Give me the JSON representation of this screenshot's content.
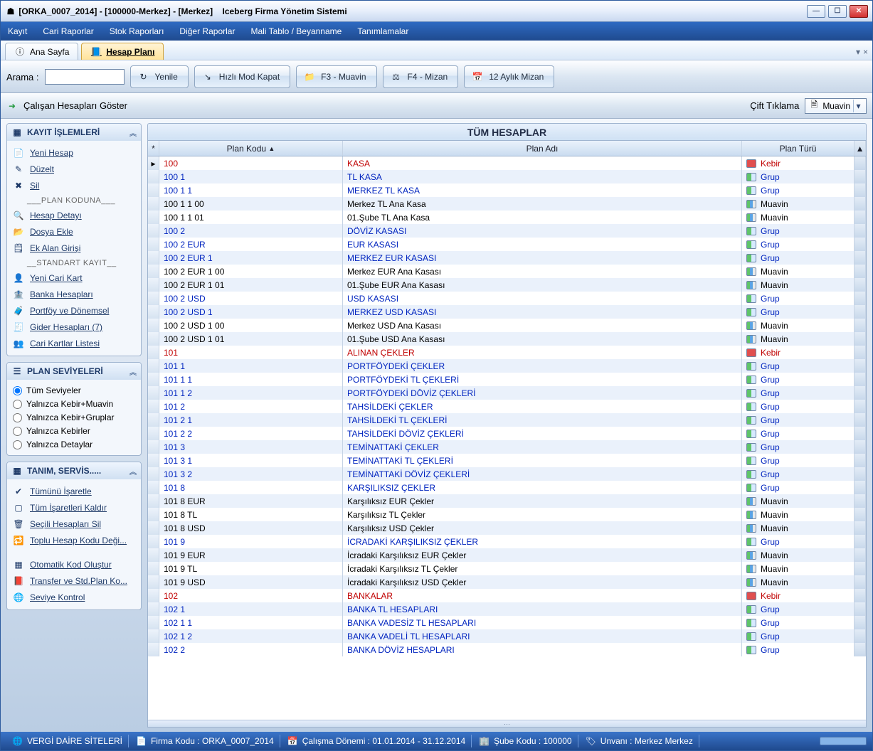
{
  "window": {
    "title_left": "[ORKA_0007_2014]   -   [100000-Merkez]   -   [Merkez]",
    "title_right": "Iceberg Firma Yönetim Sistemi"
  },
  "menubar": [
    "Kayıt",
    "Cari Raporlar",
    "Stok Raporları",
    "Diğer Raporlar",
    "Mali Tablo / Beyanname",
    "Tanımlamalar"
  ],
  "tabs": {
    "items": [
      {
        "icon": "info",
        "label": "Ana Sayfa",
        "active": false
      },
      {
        "icon": "book",
        "label": "Hesap Planı",
        "active": true
      }
    ]
  },
  "toolbar": {
    "search_label": "Arama :",
    "buttons": [
      {
        "key": "refresh",
        "label": "Yenile",
        "icon": "↻"
      },
      {
        "key": "quickclose",
        "label": "Hızlı Mod Kapat",
        "icon": "↘"
      },
      {
        "key": "f3",
        "label": "F3 - Muavin",
        "icon": "📁"
      },
      {
        "key": "f4",
        "label": "F4 - Mizan",
        "icon": "⚖"
      },
      {
        "key": "twelve",
        "label": "12 Aylık Mizan",
        "icon": "📅"
      }
    ]
  },
  "subbar": {
    "left_label": "Çalışan Hesapları Göster",
    "right_label": "Çift Tıklama",
    "dropdown_value": "Muavin"
  },
  "side": {
    "panel1": {
      "title": "KAYIT İŞLEMLERİ",
      "items": [
        {
          "icon": "📄",
          "label": "Yeni Hesap"
        },
        {
          "icon": "✎",
          "label": "Düzelt"
        },
        {
          "icon": "✖",
          "label": "Sil"
        },
        {
          "sep": "___PLAN KODUNA___"
        },
        {
          "icon": "🔍",
          "label": "Hesap Detayı"
        },
        {
          "icon": "📂",
          "label": "Dosya Ekle"
        },
        {
          "icon": "🗒",
          "label": "Ek Alan Girişi"
        },
        {
          "sep": "__STANDART KAYIT__"
        },
        {
          "icon": "👤",
          "label": "Yeni Cari Kart"
        },
        {
          "icon": "🏦",
          "label": "Banka Hesapları"
        },
        {
          "icon": "🧳",
          "label": "Portföy ve Dönemsel"
        },
        {
          "icon": "🧾",
          "label": "Gider Hesapları (7)"
        },
        {
          "icon": "👥",
          "label": "Cari Kartlar Listesi"
        }
      ]
    },
    "panel2": {
      "title": "PLAN SEVİYELERİ",
      "options": [
        {
          "label": "Tüm Seviyeler",
          "checked": true
        },
        {
          "label": "Yalnızca Kebir+Muavin",
          "checked": false
        },
        {
          "label": "Yalnızca Kebir+Gruplar",
          "checked": false
        },
        {
          "label": "Yalnızca Kebirler",
          "checked": false
        },
        {
          "label": "Yalnızca Detaylar",
          "checked": false
        }
      ]
    },
    "panel3": {
      "title": "TANIM, SERVİS.....",
      "items": [
        {
          "icon": "✔",
          "label": "Tümünü İşaretle"
        },
        {
          "icon": "▢",
          "label": "Tüm İşaretleri Kaldır"
        },
        {
          "icon": "🗑",
          "label": "Seçili Hesapları Sil"
        },
        {
          "icon": "🔁",
          "label": "Toplu Hesap Kodu Deği..."
        },
        {
          "spacer": true
        },
        {
          "icon": "▦",
          "label": "Otomatik Kod Oluştur"
        },
        {
          "icon": "📕",
          "label": "Transfer ve Std.Plan Ko..."
        },
        {
          "icon": "🌐",
          "label": "Seviye Kontrol"
        }
      ]
    }
  },
  "grid": {
    "title": "TÜM HESAPLAR",
    "columns": [
      "Plan Kodu",
      "Plan Adı",
      "Plan Türü"
    ],
    "rows": [
      {
        "code": "100",
        "name": "KASA",
        "type": "Kebir"
      },
      {
        "code": "100 1",
        "name": "TL KASA",
        "type": "Grup"
      },
      {
        "code": "100 1 1",
        "name": "MERKEZ  TL  KASA",
        "type": "Grup"
      },
      {
        "code": "100 1 1 00",
        "name": "Merkez  TL  Ana Kasa",
        "type": "Muavin"
      },
      {
        "code": "100 1 1 01",
        "name": "01.Şube TL  Ana Kasa",
        "type": "Muavin"
      },
      {
        "code": "100 2",
        "name": "DÖVİZ KASASI",
        "type": "Grup"
      },
      {
        "code": "100 2 EUR",
        "name": "EUR KASASI",
        "type": "Grup"
      },
      {
        "code": "100 2 EUR 1",
        "name": "MERKEZ  EUR KASASI",
        "type": "Grup"
      },
      {
        "code": "100 2 EUR 1 00",
        "name": "Merkez  EUR Ana Kasası",
        "type": "Muavin"
      },
      {
        "code": "100 2 EUR 1 01",
        "name": "01.Şube EUR Ana Kasası",
        "type": "Muavin"
      },
      {
        "code": "100 2 USD",
        "name": "USD  KASASI",
        "type": "Grup"
      },
      {
        "code": "100 2 USD 1",
        "name": "MERKEZ  USD KASASI",
        "type": "Grup"
      },
      {
        "code": "100 2 USD 1 00",
        "name": "Merkez  USD Ana Kasası",
        "type": "Muavin"
      },
      {
        "code": "100 2 USD 1 01",
        "name": "01.Şube USD Ana Kasası",
        "type": "Muavin"
      },
      {
        "code": "101",
        "name": "ALINAN ÇEKLER",
        "type": "Kebir"
      },
      {
        "code": "101 1",
        "name": "PORTFÖYDEKİ ÇEKLER",
        "type": "Grup"
      },
      {
        "code": "101 1 1",
        "name": "PORTFÖYDEKİ TL  ÇEKLERİ",
        "type": "Grup"
      },
      {
        "code": "101 1 2",
        "name": "PORTFÖYDEKİ DÖVİZ ÇEKLERİ",
        "type": "Grup"
      },
      {
        "code": "101 2",
        "name": "TAHSİLDEKİ  ÇEKLER",
        "type": "Grup"
      },
      {
        "code": "101 2 1",
        "name": "TAHSİLDEKİ  TL ÇEKLERİ",
        "type": "Grup"
      },
      {
        "code": "101 2 2",
        "name": "TAHSİLDEKİ  DÖVİZ ÇEKLERİ",
        "type": "Grup"
      },
      {
        "code": "101 3",
        "name": "TEMİNATTAKİ ÇEKLER",
        "type": "Grup"
      },
      {
        "code": "101 3 1",
        "name": "TEMİNATTAKİ TL ÇEKLERİ",
        "type": "Grup"
      },
      {
        "code": "101 3 2",
        "name": "TEMİNATTAKİ DÖVİZ ÇEKLERİ",
        "type": "Grup"
      },
      {
        "code": "101 8",
        "name": "KARŞILIKSIZ ÇEKLER",
        "type": "Grup"
      },
      {
        "code": "101 8 EUR",
        "name": "Karşılıksız EUR Çekler",
        "type": "Muavin"
      },
      {
        "code": "101 8 TL",
        "name": "Karşılıksız TL Çekler",
        "type": "Muavin"
      },
      {
        "code": "101 8 USD",
        "name": "Karşılıksız USD Çekler",
        "type": "Muavin"
      },
      {
        "code": "101 9",
        "name": "İCRADAKİ KARŞILIKSIZ ÇEKLER",
        "type": "Grup"
      },
      {
        "code": "101 9 EUR",
        "name": "İcradaki Karşılıksız EUR Çekler",
        "type": "Muavin"
      },
      {
        "code": "101 9 TL",
        "name": "İcradaki Karşılıksız TL Çekler",
        "type": "Muavin"
      },
      {
        "code": "101 9 USD",
        "name": "İcradaki Karşılıksız USD Çekler",
        "type": "Muavin"
      },
      {
        "code": "102",
        "name": "BANKALAR",
        "type": "Kebir"
      },
      {
        "code": "102 1",
        "name": "BANKA TL   HESAPLARI",
        "type": "Grup"
      },
      {
        "code": "102 1 1",
        "name": "BANKA  VADESİZ TL HESAPLARI",
        "type": "Grup"
      },
      {
        "code": "102 1 2",
        "name": "BANKA  VADELİ  TL HESAPLARI",
        "type": "Grup"
      },
      {
        "code": "102 2",
        "name": "BANKA DÖVİZ HESAPLARI",
        "type": "Grup"
      }
    ]
  },
  "statusbar": {
    "items": [
      {
        "icon": "🌐",
        "label": "VERGİ DAİRE SİTELERİ"
      },
      {
        "icon": "📄",
        "label": "Firma Kodu : ORKA_0007_2014"
      },
      {
        "icon": "📅",
        "label": "Çalışma Dönemi : 01.01.2014 - 31.12.2014"
      },
      {
        "icon": "🏢",
        "label": "Şube Kodu : 100000"
      },
      {
        "icon": "🏷",
        "label": "Unvanı : Merkez Merkez"
      }
    ]
  }
}
